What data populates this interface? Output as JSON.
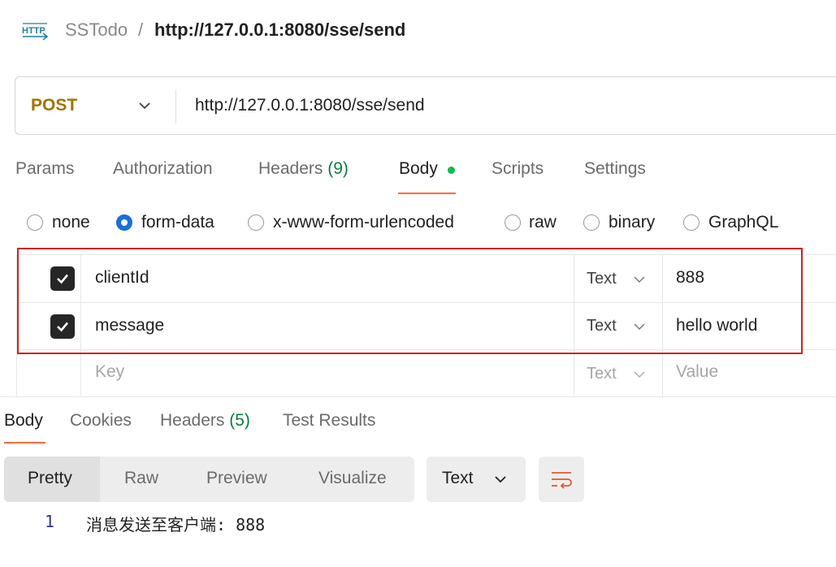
{
  "header": {
    "icon": "http-request-icon",
    "icon_text": "HTTP",
    "collection": "SSTodo",
    "separator": "/",
    "request_name": "http://127.0.0.1:8080/sse/send"
  },
  "request": {
    "method": "POST",
    "url": "http://127.0.0.1:8080/sse/send"
  },
  "request_tabs": [
    {
      "label": "Params"
    },
    {
      "label": "Authorization"
    },
    {
      "label": "Headers",
      "count": "(9)"
    },
    {
      "label": "Body",
      "active": true
    },
    {
      "label": "Scripts"
    },
    {
      "label": "Settings"
    }
  ],
  "body_types": [
    {
      "label": "none",
      "checked": false
    },
    {
      "label": "form-data",
      "checked": true
    },
    {
      "label": "x-www-form-urlencoded",
      "checked": false
    },
    {
      "label": "raw",
      "checked": false
    },
    {
      "label": "binary",
      "checked": false
    },
    {
      "label": "GraphQL",
      "checked": false
    }
  ],
  "form_data": {
    "rows": [
      {
        "checked": true,
        "key": "clientId",
        "type": "Text",
        "value": "888"
      },
      {
        "checked": true,
        "key": "message",
        "type": "Text",
        "value": "hello world"
      }
    ],
    "new_row": {
      "key_placeholder": "Key",
      "type": "Text",
      "value_placeholder": "Value"
    }
  },
  "response_tabs": [
    {
      "label": "Body",
      "active": true
    },
    {
      "label": "Cookies"
    },
    {
      "label": "Headers",
      "count": "(5)"
    },
    {
      "label": "Test Results"
    }
  ],
  "response_view": {
    "modes": [
      "Pretty",
      "Raw",
      "Preview",
      "Visualize"
    ],
    "active_mode": "Pretty",
    "format": "Text",
    "wrap_icon": "wrap-lines-icon"
  },
  "response_body": [
    {
      "line": "1",
      "text": "消息发送至客户端: 888"
    }
  ],
  "colors": {
    "method": "#a37300",
    "accent": "#ff6c37",
    "status_dot": "#0cbb52",
    "radio_checked": "#1a6fd8",
    "highlight_box": "#d0201d"
  }
}
